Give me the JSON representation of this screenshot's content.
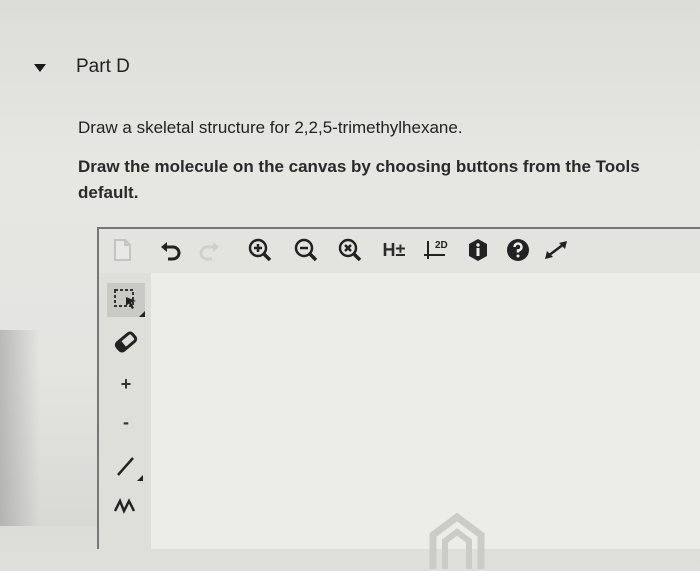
{
  "part": {
    "title": "Part D"
  },
  "question": {
    "prompt": "Draw a skeletal structure for 2,2,5-trimethylhexane.",
    "instructions_line1": "Draw the molecule on the canvas by choosing buttons from the Tools",
    "instructions_line2": "default."
  },
  "toolbar": {
    "items": [
      {
        "icon": "new-page-icon"
      },
      {
        "icon": "undo-icon"
      },
      {
        "icon": "redo-icon"
      },
      {
        "icon": "zoom-in-icon"
      },
      {
        "icon": "zoom-out-icon"
      },
      {
        "icon": "zoom-reset-icon"
      },
      {
        "label": "H±",
        "icon": "hydrogen-toggle-icon"
      },
      {
        "label": "2D",
        "icon": "clean-2d-icon"
      },
      {
        "icon": "info-icon"
      },
      {
        "icon": "help-icon"
      },
      {
        "icon": "expand-icon"
      }
    ]
  },
  "tools": {
    "items": [
      {
        "icon": "select-lasso-icon"
      },
      {
        "icon": "eraser-icon"
      },
      {
        "label": "+",
        "icon": "positive-charge-icon"
      },
      {
        "label": "-",
        "icon": "negative-charge-icon"
      },
      {
        "icon": "single-bond-icon"
      },
      {
        "icon": "chain-icon"
      }
    ]
  },
  "colors": {
    "background": "#e4e4e1",
    "text": "#222222",
    "border": "#777777"
  }
}
